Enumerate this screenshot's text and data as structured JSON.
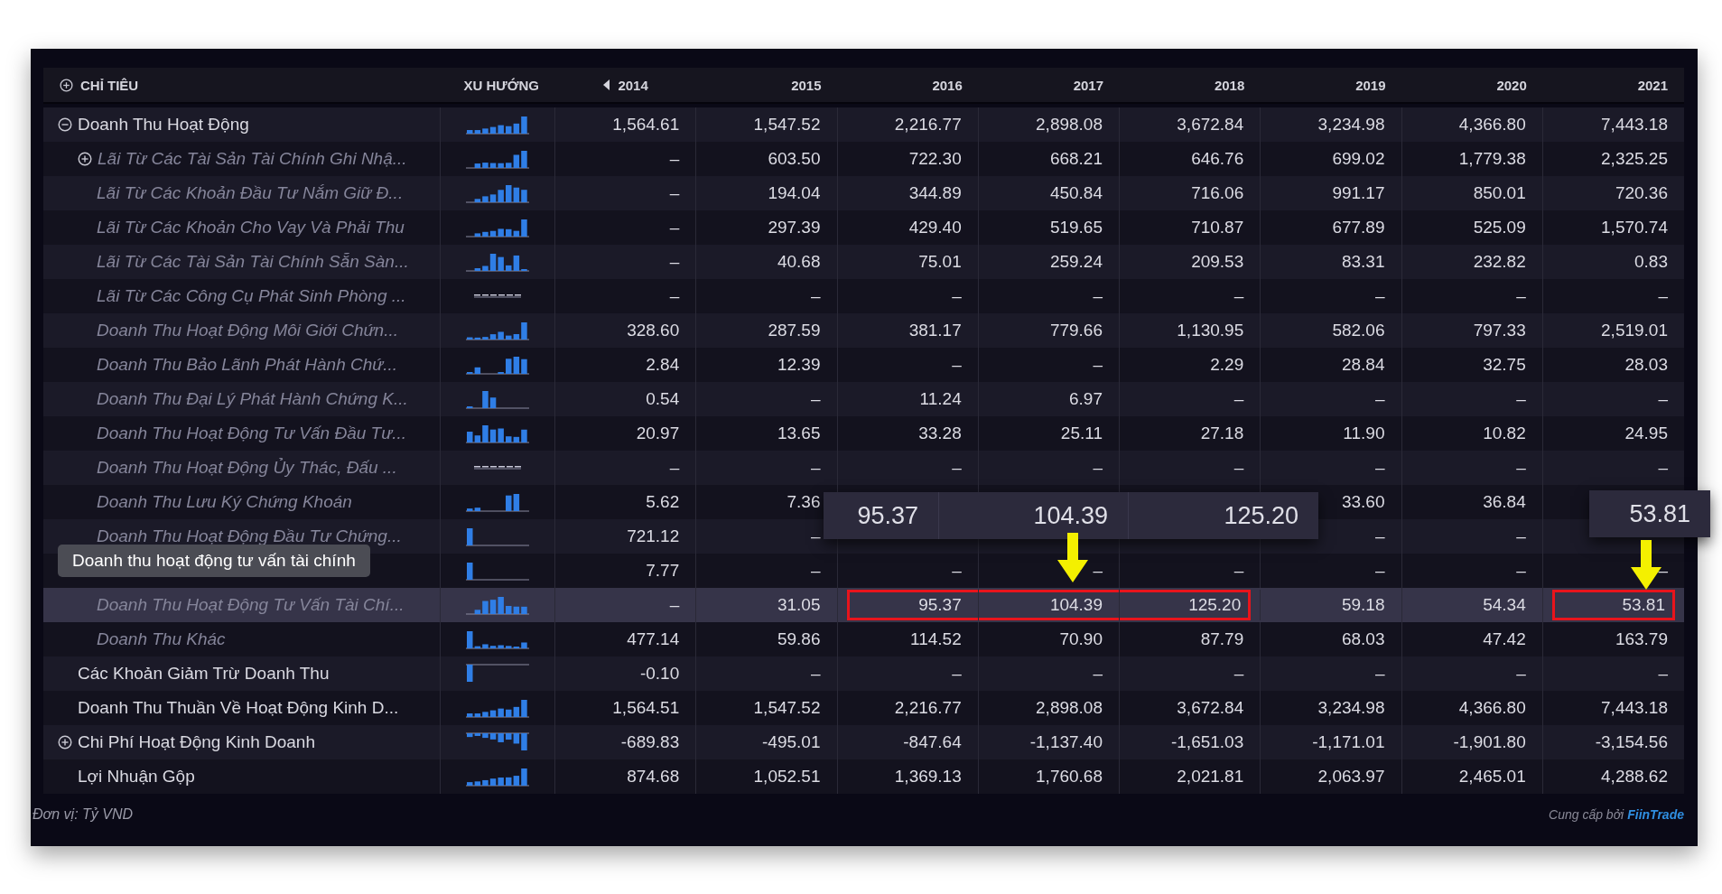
{
  "header": {
    "label_column": "CHỈ TIÊU",
    "trend_column": "XU HƯỚNG",
    "years": [
      "2014",
      "2015",
      "2016",
      "2017",
      "2018",
      "2019",
      "2020",
      "2021"
    ]
  },
  "rows": [
    {
      "label": "Doanh Thu Hoạt Động",
      "expanded": true,
      "selected": false,
      "values": [
        "1,564.61",
        "1,547.52",
        "2,216.77",
        "2,898.08",
        "3,672.84",
        "3,234.98",
        "4,366.80",
        "7,443.18"
      ],
      "children": [
        {
          "label": "Lãi Từ Các Tài Sản Tài Chính Ghi Nhậ...",
          "expanded": false,
          "selected": false,
          "values": [
            "–",
            "603.50",
            "722.30",
            "668.21",
            "646.76",
            "699.02",
            "1,779.38",
            "2,325.25"
          ]
        },
        {
          "label": "Lãi Từ Các Khoản Đầu Tư Nắm Giữ Đ...",
          "selected": false,
          "values": [
            "–",
            "194.04",
            "344.89",
            "450.84",
            "716.06",
            "991.17",
            "850.01",
            "720.36"
          ]
        },
        {
          "label": "Lãi Từ Các Khoản Cho Vay Và Phải Thu",
          "selected": false,
          "values": [
            "–",
            "297.39",
            "429.40",
            "519.65",
            "710.87",
            "677.89",
            "525.09",
            "1,570.74"
          ]
        },
        {
          "label": "Lãi Từ Các Tài Sản Tài Chính Sẵn Sàn...",
          "selected": false,
          "values": [
            "–",
            "40.68",
            "75.01",
            "259.24",
            "209.53",
            "83.31",
            "232.82",
            "0.83"
          ]
        },
        {
          "label": "Lãi Từ Các Công Cụ Phát Sinh Phòng ...",
          "selected": false,
          "values": [
            "–",
            "–",
            "–",
            "–",
            "–",
            "–",
            "–",
            "–"
          ]
        },
        {
          "label": "Doanh Thu Hoạt Động Môi Giới Chứn...",
          "selected": false,
          "values": [
            "328.60",
            "287.59",
            "381.17",
            "779.66",
            "1,130.95",
            "582.06",
            "797.33",
            "2,519.01"
          ]
        },
        {
          "label": "Doanh Thu Bảo Lãnh Phát Hành Chứ...",
          "selected": false,
          "values": [
            "2.84",
            "12.39",
            "–",
            "–",
            "2.29",
            "28.84",
            "32.75",
            "28.03"
          ]
        },
        {
          "label": "Doanh Thu Đại Lý Phát Hành Chứng K...",
          "selected": false,
          "values": [
            "0.54",
            "–",
            "11.24",
            "6.97",
            "–",
            "–",
            "–",
            "–"
          ]
        },
        {
          "label": "Doanh Thu Hoạt Động Tư Vấn Đầu Tư...",
          "selected": false,
          "values": [
            "20.97",
            "13.65",
            "33.28",
            "25.11",
            "27.18",
            "11.90",
            "10.82",
            "24.95"
          ]
        },
        {
          "label": "Doanh Thu Hoạt Động Ủy Thác, Đấu ...",
          "selected": false,
          "values": [
            "–",
            "–",
            "–",
            "–",
            "–",
            "–",
            "–",
            "–"
          ]
        },
        {
          "label": "Doanh Thu Lưu Ký Chứng Khoán",
          "selected": false,
          "cells": [
            {
              "text": "5.62",
              "covered": false
            },
            {
              "text": "7.36",
              "covered": false
            },
            {
              "covered": true
            },
            {
              "covered": true
            },
            {
              "covered": true
            },
            {
              "text": "33.60",
              "covered": false
            },
            {
              "text": "36.84",
              "covered": false
            },
            {
              "covered": true
            }
          ]
        },
        {
          "label": "Doanh Thu Hoạt Động Đầu Tư Chứng...",
          "selected": false,
          "cells": [
            {
              "text": "721.12",
              "covered": false
            },
            {
              "text": "–",
              "covered": false
            },
            {
              "covered": true
            },
            {
              "covered": true
            },
            {
              "covered": true
            },
            {
              "text": "–",
              "covered": false
            },
            {
              "text": "–",
              "covered": false
            },
            {
              "covered": true
            }
          ]
        },
        {
          "selected": false,
          "values": [
            "7.77",
            "–",
            "–",
            "–",
            "–",
            "–",
            "–",
            "–"
          ]
        },
        {
          "label": "Doanh Thu Hoạt Động Tư Vấn Tài Chí...",
          "selected": true,
          "cells": [
            {
              "text": "–",
              "boxed": false
            },
            {
              "text": "31.05",
              "boxed": false
            },
            {
              "text": "95.37",
              "boxed": true
            },
            {
              "text": "104.39",
              "boxed": true
            },
            {
              "text": "125.20",
              "boxed": true
            },
            {
              "text": "59.18",
              "boxed": false
            },
            {
              "text": "54.34",
              "boxed": false
            },
            {
              "text": "53.81",
              "boxed": true
            }
          ]
        },
        {
          "label": "Doanh Thu Khác",
          "selected": false,
          "values": [
            "477.14",
            "59.86",
            "114.52",
            "70.90",
            "87.79",
            "68.03",
            "47.42",
            "163.79"
          ]
        }
      ]
    },
    {
      "label": "Các Khoản Giảm Trừ Doanh Thu",
      "selected": false,
      "values": [
        "-0.10",
        "–",
        "–",
        "–",
        "–",
        "–",
        "–",
        "–"
      ]
    },
    {
      "label": "Doanh Thu Thuần Về Hoạt Động Kinh D...",
      "selected": false,
      "values": [
        "1,564.51",
        "1,547.52",
        "2,216.77",
        "2,898.08",
        "3,672.84",
        "3,234.98",
        "4,366.80",
        "7,443.18"
      ]
    },
    {
      "label": "Chi Phí Hoạt Động Kinh Doanh",
      "expanded": false,
      "selected": false,
      "values": [
        "-689.83",
        "-495.01",
        "-847.64",
        "-1,137.40",
        "-1,651.03",
        "-1,171.01",
        "-1,901.80",
        "-3,154.56"
      ]
    },
    {
      "label": "Lợi Nhuận Gộp",
      "selected": false,
      "values": [
        "874.68",
        "1,052.51",
        "1,369.13",
        "1,760.68",
        "2,021.81",
        "2,063.97",
        "2,465.01",
        "4,288.62"
      ]
    }
  ],
  "tooltip": "Doanh thu hoạt động tư vấn tài chính",
  "callouts": [
    {
      "values": [
        "95.37",
        "104.39",
        "125.20"
      ]
    },
    {
      "values": [
        "53.81"
      ]
    }
  ],
  "footer": {
    "unit": "Đơn vị: Tỷ VND",
    "source_prefix": "Cung cấp bởi",
    "source_brand": "FiinTrade"
  }
}
